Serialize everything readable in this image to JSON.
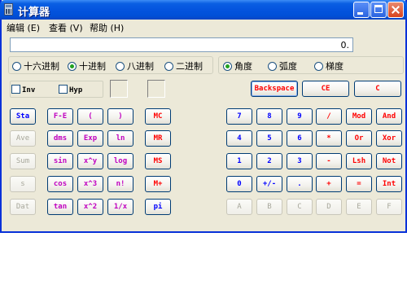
{
  "window": {
    "title": "计算器"
  },
  "menu": [
    {
      "label": "编辑 (E)"
    },
    {
      "label": "查看 (V)"
    },
    {
      "label": "帮助 (H)"
    }
  ],
  "display": {
    "value": "0."
  },
  "base_modes": [
    {
      "label": "十六进制",
      "selected": false
    },
    {
      "label": "十进制",
      "selected": true
    },
    {
      "label": "八进制",
      "selected": false
    },
    {
      "label": "二进制",
      "selected": false
    }
  ],
  "angle_modes": [
    {
      "label": "角度",
      "selected": true
    },
    {
      "label": "弧度",
      "selected": false
    },
    {
      "label": "梯度",
      "selected": false
    }
  ],
  "checks": {
    "inv": "Inv",
    "hyp": "Hyp"
  },
  "edit_buttons": {
    "backspace": "Backspace",
    "ce": "CE",
    "c": "C"
  },
  "stat_buttons": [
    "Sta",
    "Ave",
    "Sum",
    "s",
    "Dat"
  ],
  "sci_buttons": [
    [
      "F-E",
      "(",
      ")"
    ],
    [
      "dms",
      "Exp",
      "ln"
    ],
    [
      "sin",
      "x^y",
      "log"
    ],
    [
      "cos",
      "x^3",
      "n!"
    ],
    [
      "tan",
      "x^2",
      "1/x"
    ]
  ],
  "memory_buttons": [
    "MC",
    "MR",
    "MS",
    "M+",
    "pi"
  ],
  "numpad": [
    [
      "7",
      "8",
      "9",
      "/",
      "Mod",
      "And"
    ],
    [
      "4",
      "5",
      "6",
      "*",
      "Or",
      "Xor"
    ],
    [
      "1",
      "2",
      "3",
      "-",
      "Lsh",
      "Not"
    ],
    [
      "0",
      "+/-",
      ".",
      "+",
      "=",
      "Int"
    ],
    [
      "A",
      "B",
      "C",
      "D",
      "E",
      "F"
    ]
  ],
  "colors": {
    "title_bar": "#0454de",
    "face": "#ece9d8",
    "red": "#ff0000",
    "blue": "#0000ff",
    "purple": "#c000c0"
  }
}
